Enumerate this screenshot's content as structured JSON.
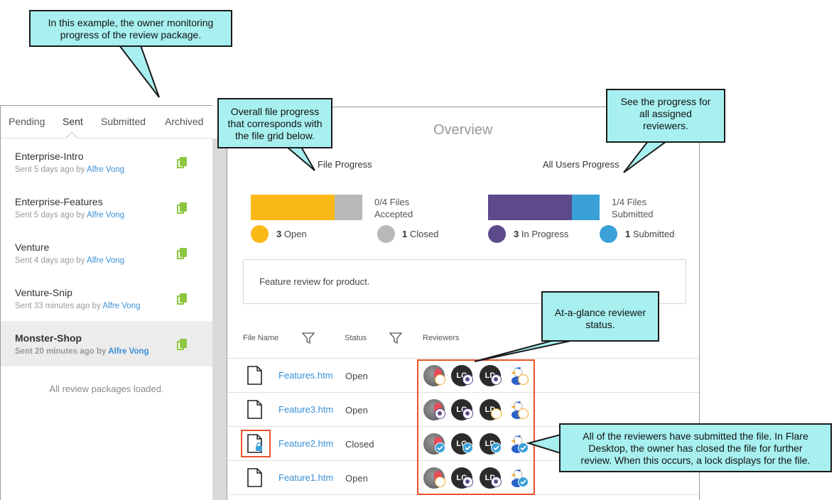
{
  "tabs": [
    {
      "label": "Pending"
    },
    {
      "label": "Sent"
    },
    {
      "label": "Submitted"
    },
    {
      "label": "Archived"
    }
  ],
  "packages": [
    {
      "name": "Enterprise-Intro",
      "meta": "Sent 5 days ago by",
      "author": "Alfre Vong"
    },
    {
      "name": "Enterprise-Features",
      "meta": "Sent 5 days ago by",
      "author": "Alfre Vong"
    },
    {
      "name": "Venture",
      "meta": "Sent 4 days ago by",
      "author": "Alfre Vong"
    },
    {
      "name": "Venture-Snip",
      "meta": "Sent 33 minutes ago by",
      "author": "Alfre Vong"
    },
    {
      "name": "Monster-Shop",
      "meta": "Sent 20 minutes ago by",
      "author": "Alfre Vong"
    }
  ],
  "packages_footer": "All review packages loaded.",
  "overview": {
    "title": "Overview",
    "file_progress_label": "File Progress",
    "users_progress_label": "All Users Progress",
    "files_caption_1": "0/4 Files",
    "files_caption_2": "Accepted",
    "users_caption_1": "1/4 Files",
    "users_caption_2": "Submitted",
    "open_count": "3",
    "open_label": "Open",
    "closed_count": "1",
    "closed_label": "Closed",
    "inprogress_count": "3",
    "inprogress_label": "In Progress",
    "submitted_count": "1",
    "submitted_label": "Submitted",
    "file_progress_open_fraction": 0.75,
    "users_progress_inprogress_fraction": 0.75,
    "description": "Feature review for product."
  },
  "grid": {
    "col_file_name": "File Name",
    "col_status": "Status",
    "col_reviewers": "Reviewers",
    "rows": [
      {
        "file": "Features.htm",
        "status": "Open",
        "locked": false,
        "reviewers": [
          {
            "avatar": "photo",
            "initials": "",
            "state": "pending"
          },
          {
            "avatar": "initials",
            "initials": "LG",
            "state": "progress"
          },
          {
            "avatar": "initials",
            "initials": "LD",
            "state": "progress"
          },
          {
            "avatar": "duck",
            "initials": "",
            "state": "pending"
          }
        ]
      },
      {
        "file": "Feature3.htm",
        "status": "Open",
        "locked": false,
        "reviewers": [
          {
            "avatar": "photo",
            "initials": "",
            "state": "progress"
          },
          {
            "avatar": "initials",
            "initials": "LG",
            "state": "progress"
          },
          {
            "avatar": "initials",
            "initials": "LD",
            "state": "pending"
          },
          {
            "avatar": "duck",
            "initials": "",
            "state": "pending"
          }
        ]
      },
      {
        "file": "Feature2.htm",
        "status": "Closed",
        "locked": true,
        "reviewers": [
          {
            "avatar": "photo",
            "initials": "",
            "state": "done"
          },
          {
            "avatar": "initials",
            "initials": "LG",
            "state": "done"
          },
          {
            "avatar": "initials",
            "initials": "LD",
            "state": "done"
          },
          {
            "avatar": "duck",
            "initials": "",
            "state": "done"
          }
        ]
      },
      {
        "file": "Feature1.htm",
        "status": "Open",
        "locked": false,
        "reviewers": [
          {
            "avatar": "photo",
            "initials": "",
            "state": "pending"
          },
          {
            "avatar": "initials",
            "initials": "LG",
            "state": "progress"
          },
          {
            "avatar": "initials",
            "initials": "LD",
            "state": "progress"
          },
          {
            "avatar": "duck",
            "initials": "",
            "state": "done"
          }
        ]
      }
    ]
  },
  "colors": {
    "open": "#fbb917",
    "closed": "#b8b8b8",
    "in_progress": "#5c4a8b",
    "submitted": "#3aa0d8",
    "link": "#3a8fd6",
    "callout": "#a8f0f0",
    "highlight": "#e8532b"
  },
  "callouts": {
    "owner": [
      "In this example, the owner monitoring",
      "progress of the review package."
    ],
    "file_progress": [
      "Overall file progress",
      "that corresponds with",
      "the file grid below."
    ],
    "reviewers_progress": [
      "See the progress for",
      "all assigned",
      "reviewers."
    ],
    "at_a_glance": [
      "At-a-glance reviewer",
      "status."
    ],
    "lock": [
      "All of the reviewers have submitted the file. In Flare",
      "Desktop, the owner has closed the file for further",
      "review. When this occurs, a lock displays for the file."
    ]
  }
}
